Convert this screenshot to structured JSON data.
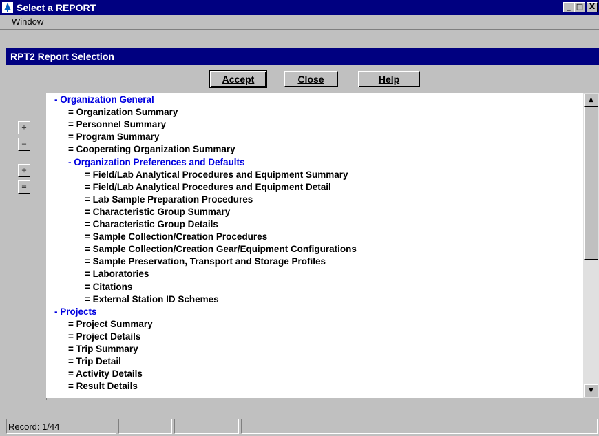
{
  "window": {
    "title": "Select a REPORT",
    "controls": {
      "minimize": "_",
      "maximize": "□",
      "close": "X"
    }
  },
  "menubar": {
    "items": [
      "Window"
    ]
  },
  "sheet": {
    "title": "RPT2 Report Selection"
  },
  "toolbar": {
    "accept_label": "Accept",
    "close_label": "Close",
    "help_label": "Help"
  },
  "tree_tools": [
    "expand-icon",
    "collapse-icon",
    "expand-all-icon",
    "collapse-all-icon"
  ],
  "tree": {
    "rows": [
      {
        "text": "- Organization General",
        "header": true,
        "level": 0
      },
      {
        "text": "= Organization Summary",
        "header": false,
        "level": 1
      },
      {
        "text": "= Personnel Summary",
        "header": false,
        "level": 1
      },
      {
        "text": "= Program Summary",
        "header": false,
        "level": 1
      },
      {
        "text": "= Cooperating Organization Summary",
        "header": false,
        "level": 1
      },
      {
        "text": "- Organization Preferences and Defaults",
        "header": true,
        "level": 1
      },
      {
        "text": "= Field/Lab Analytical Procedures and Equipment Summary",
        "header": false,
        "level": 2
      },
      {
        "text": "= Field/Lab Analytical Procedures and Equipment Detail",
        "header": false,
        "level": 2
      },
      {
        "text": "= Lab Sample Preparation Procedures",
        "header": false,
        "level": 2
      },
      {
        "text": "= Characteristic Group Summary",
        "header": false,
        "level": 2
      },
      {
        "text": "= Characteristic Group Details",
        "header": false,
        "level": 2
      },
      {
        "text": "= Sample Collection/Creation Procedures",
        "header": false,
        "level": 2
      },
      {
        "text": "= Sample Collection/Creation Gear/Equipment Configurations",
        "header": false,
        "level": 2
      },
      {
        "text": "= Sample Preservation, Transport and Storage Profiles",
        "header": false,
        "level": 2
      },
      {
        "text": "= Laboratories",
        "header": false,
        "level": 2
      },
      {
        "text": "= Citations",
        "header": false,
        "level": 2
      },
      {
        "text": "= External Station ID Schemes",
        "header": false,
        "level": 2
      },
      {
        "text": "- Projects",
        "header": true,
        "level": 0
      },
      {
        "text": "= Project Summary",
        "header": false,
        "level": 1
      },
      {
        "text": "= Project Details",
        "header": false,
        "level": 1
      },
      {
        "text": "= Trip Summary",
        "header": false,
        "level": 1
      },
      {
        "text": "= Trip Detail",
        "header": false,
        "level": 1
      },
      {
        "text": "= Activity Details",
        "header": false,
        "level": 1
      },
      {
        "text": "= Result Details",
        "header": false,
        "level": 1
      }
    ]
  },
  "status": {
    "record": "Record: 1/44"
  },
  "colors": {
    "title_bar": "#000080",
    "header_text": "#0000e0",
    "face": "#c0c0c0"
  }
}
